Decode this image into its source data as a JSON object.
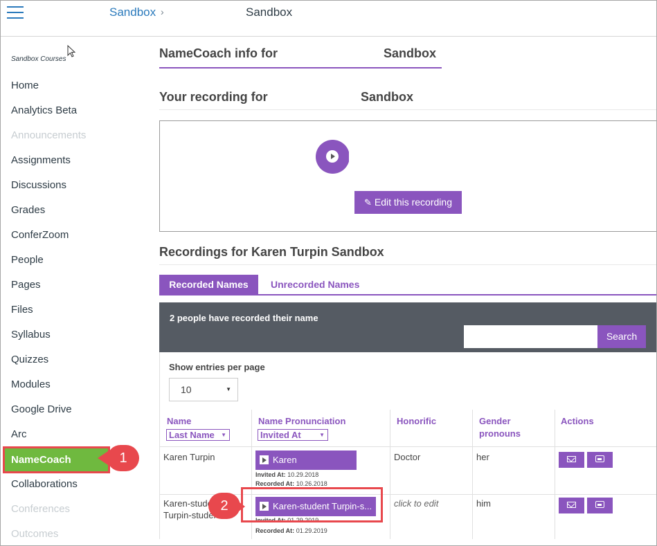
{
  "header": {
    "breadcrumb_root": "Sandbox",
    "breadcrumb_sep": "›",
    "breadcrumb_current": "Sandbox"
  },
  "sidebar": {
    "subtitle": "Sandbox Courses",
    "items": [
      {
        "label": "Home",
        "disabled": false
      },
      {
        "label": "Analytics Beta",
        "disabled": false
      },
      {
        "label": "Announcements",
        "disabled": true
      },
      {
        "label": "Assignments",
        "disabled": false
      },
      {
        "label": "Discussions",
        "disabled": false
      },
      {
        "label": "Grades",
        "disabled": false
      },
      {
        "label": "ConferZoom",
        "disabled": false
      },
      {
        "label": "People",
        "disabled": false
      },
      {
        "label": "Pages",
        "disabled": false
      },
      {
        "label": "Files",
        "disabled": false
      },
      {
        "label": "Syllabus",
        "disabled": false
      },
      {
        "label": "Quizzes",
        "disabled": false
      },
      {
        "label": "Modules",
        "disabled": false
      },
      {
        "label": "Google Drive",
        "disabled": false
      },
      {
        "label": "Arc",
        "disabled": false
      },
      {
        "label": "NameCoach",
        "disabled": false,
        "active": true
      },
      {
        "label": "Collaborations",
        "disabled": false
      },
      {
        "label": "Conferences",
        "disabled": true
      },
      {
        "label": "Outcomes",
        "disabled": true
      }
    ]
  },
  "callouts": {
    "one": "1",
    "two": "2"
  },
  "main": {
    "title_left": "NameCoach info for",
    "title_right": "Sandbox",
    "recording_title_left": "Your recording for",
    "recording_title_right": "Sandbox",
    "edit_recording_label": "Edit this recording",
    "section_title": "Recordings for Karen Turpin Sandbox",
    "tabs": {
      "recorded": "Recorded Names",
      "unrecorded": "Unrecorded Names"
    },
    "panel_text": "2 people have recorded their name",
    "search_label": "Search",
    "search_value": "",
    "show_entries_label": "Show entries per page",
    "entries_value": "10",
    "columns": {
      "name": "Name",
      "name_sort": "Last Name",
      "pronunciation": "Name Pronunciation",
      "pronunciation_sort": "Invited At",
      "honorific": "Honorific",
      "gender_line1": "Gender",
      "gender_line2": "pronouns",
      "actions": "Actions"
    },
    "rows": [
      {
        "name_line1": "Karen Turpin",
        "name_line2": "",
        "play_label": "Karen",
        "invited_label": "Invited At:",
        "invited_value": "10.29.2018",
        "recorded_label": "Recorded At:",
        "recorded_value": "10.26.2018",
        "honorific": "Doctor",
        "pronouns": "her"
      },
      {
        "name_line1": "Karen-studen",
        "name_line2": "Turpin-studen",
        "play_label": "Karen-student Turpin-s...",
        "invited_label": "Invited At:",
        "invited_value": "01.29.2019",
        "recorded_label": "Recorded At:",
        "recorded_value": "01.29.2019",
        "honorific": "click to edit",
        "pronouns": "him"
      }
    ]
  },
  "colors": {
    "brand_purple": "#8a55be",
    "link_blue": "#2b7abc",
    "callout_red": "#e8484d",
    "active_green": "#6fb93f",
    "panel_grey": "#555b63"
  }
}
